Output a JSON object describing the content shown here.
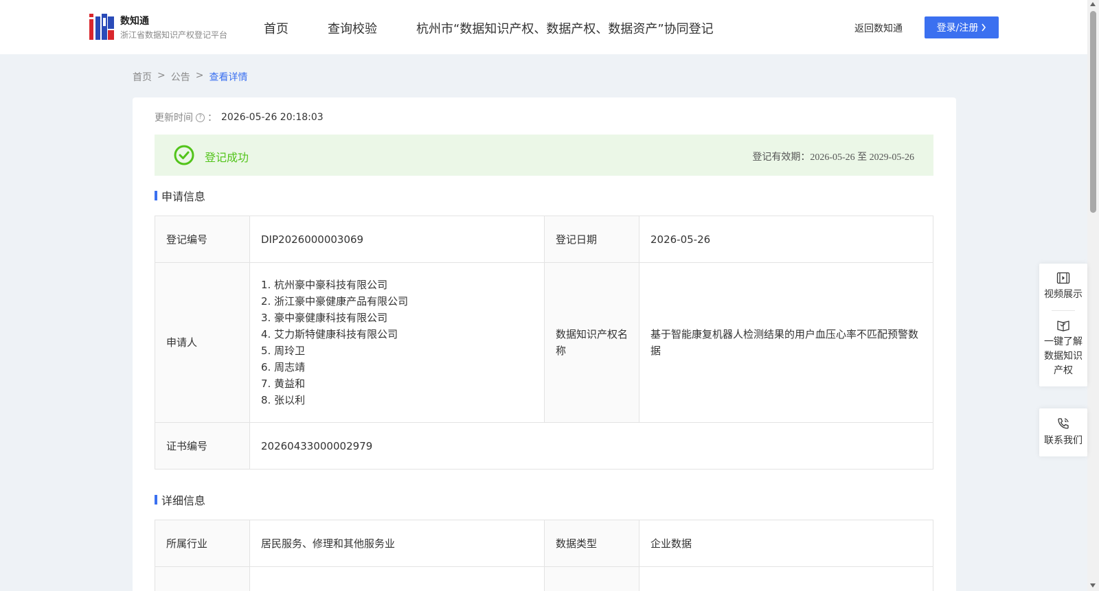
{
  "header": {
    "logo_name": "数知通",
    "logo_subtitle": "浙江省数据知识产权登记平台",
    "nav": [
      {
        "label": "首页"
      },
      {
        "label": "查询校验"
      },
      {
        "label": "杭州市“数据知识产权、数据产权、数据资产”协同登记"
      }
    ],
    "back_link": "返回数知通",
    "login_button": "登录/注册"
  },
  "breadcrumb": {
    "items": [
      "首页",
      "公告",
      "查看详情"
    ],
    "separator": ">"
  },
  "detail": {
    "update_label": "更新时间",
    "update_colon": "：",
    "update_value": "2026-05-26 20:18:03",
    "status_text": "登记成功",
    "validity_text": "登记有效期：2026-05-26 至 2029-05-26",
    "status_color": "#52c41a",
    "accent_color": "#3b70f0"
  },
  "application_info": {
    "title": "申请信息",
    "reg_no_label": "登记编号",
    "reg_no_value": "DIP2026000003069",
    "reg_date_label": "登记日期",
    "reg_date_value": "2026-05-26",
    "applicant_label": "申请人",
    "applicants": [
      "1. 杭州豪中豪科技有限公司",
      "2. 浙江豪中豪健康产品有限公司",
      "3. 豪中豪健康科技有限公司",
      "4. 艾力斯特健康科技有限公司",
      "5. 周玲卫",
      "6. 周志靖",
      "7. 黄益和",
      "8. 张以利"
    ],
    "ip_name_label": "数据知识产权名称",
    "ip_name_value": "基于智能康复机器人检测结果的用户血压心率不匹配预警数据",
    "cert_no_label": "证书编号",
    "cert_no_value": "20260433000002979"
  },
  "detail_info": {
    "title": "详细信息",
    "industry_label": "所属行业",
    "industry_value": "居民服务、修理和其他服务业",
    "data_type_label": "数据类型",
    "data_type_value": "企业数据"
  },
  "side_panel": {
    "video": "视频展示",
    "learn_lines": [
      "一键了解",
      "数据知识",
      "产权"
    ],
    "contact": "联系我们"
  }
}
